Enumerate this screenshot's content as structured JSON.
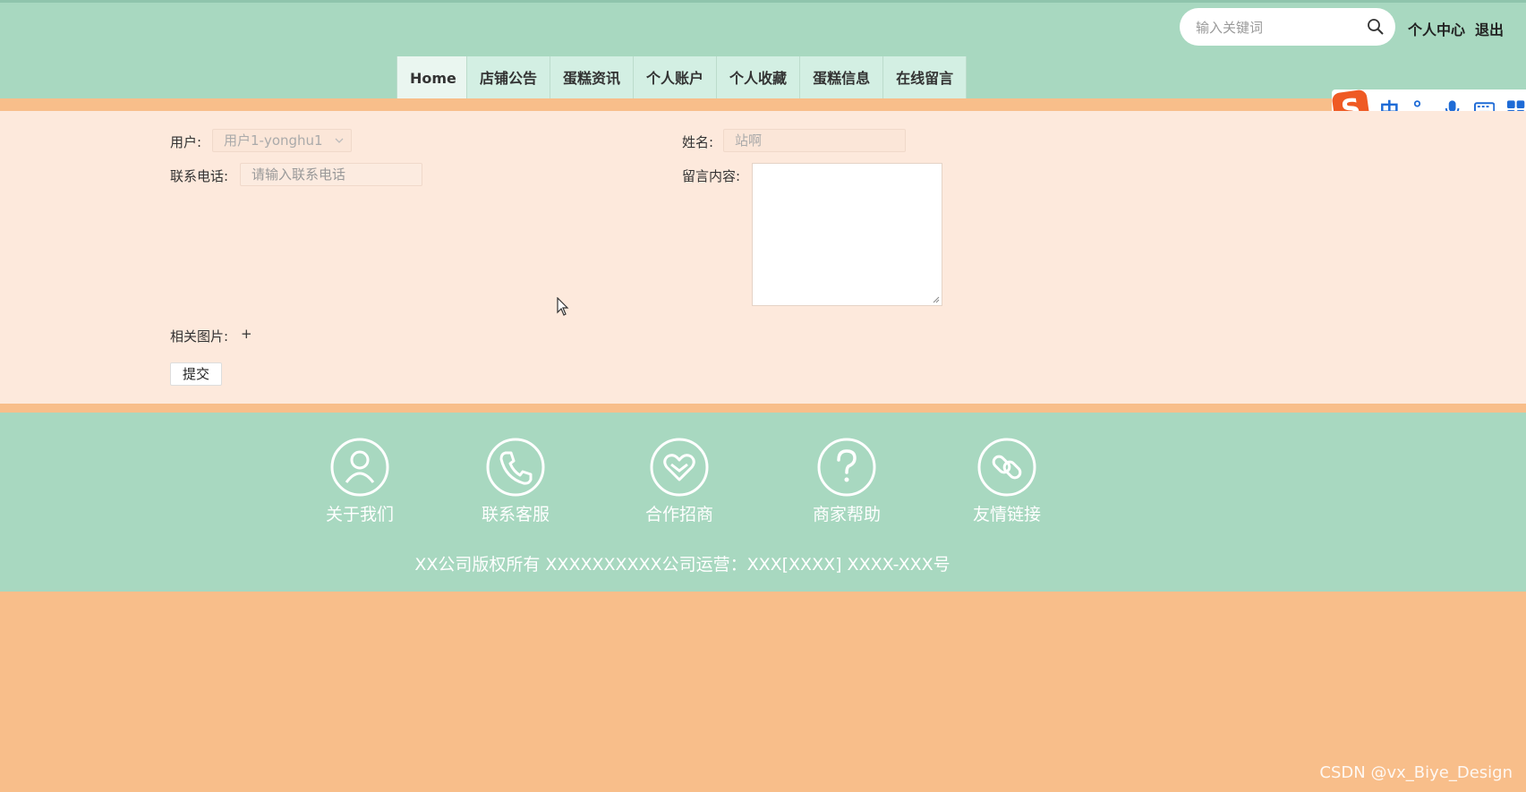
{
  "header": {
    "search": {
      "placeholder": "输入关键词",
      "icon": "search-icon"
    },
    "personal_center": "个人中心",
    "logout": "退出"
  },
  "nav": {
    "items": [
      "Home",
      "店铺公告",
      "蛋糕资讯",
      "个人账户",
      "个人收藏",
      "蛋糕信息",
      "在线留言"
    ]
  },
  "ime": {
    "logo": "S",
    "items": [
      "中",
      "°,",
      "mic-icon",
      "keyboard-icon",
      "grid-icon"
    ]
  },
  "form": {
    "user_label": "用户:",
    "user_value": "用户1-yonghu1",
    "name_label": "姓名:",
    "name_value": "站啊",
    "phone_label": "联系电话:",
    "phone_placeholder": "请输入联系电话",
    "message_label": "留言内容:",
    "image_label": "相关图片:",
    "image_add": "+",
    "submit": "提交"
  },
  "footer": {
    "items": [
      {
        "label": "关于我们",
        "icon": "user-icon"
      },
      {
        "label": "联系客服",
        "icon": "phone-icon"
      },
      {
        "label": "合作招商",
        "icon": "heart-handshake-icon"
      },
      {
        "label": "商家帮助",
        "icon": "question-icon"
      },
      {
        "label": "友情链接",
        "icon": "link-icon"
      }
    ],
    "copyright": "XX公司版权所有 XXXXXXXXXX公司运营：XXX[XXXX] XXXX-XXX号"
  },
  "watermark": "CSDN @vx_Biye_Design",
  "colors": {
    "header_bg": "#a8d8c0",
    "accent_orange": "#f8be8a",
    "content_bg": "#fde9dc"
  }
}
